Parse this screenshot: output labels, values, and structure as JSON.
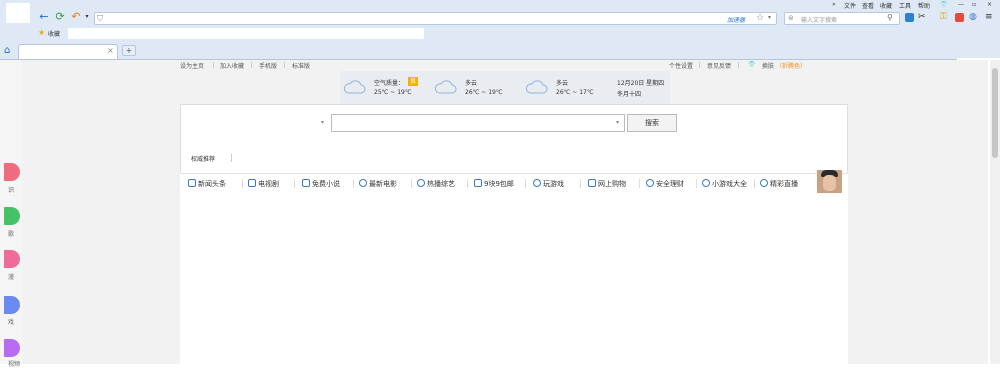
{
  "browser": {
    "menu": [
      "文件",
      "查看",
      "收藏",
      "工具",
      "帮助"
    ],
    "accelerator_label": "加速器",
    "search_placeholder": "输入文字搜索",
    "favorites_label": "收藏",
    "new_tab_symbol": "+",
    "tab_close_symbol": "×",
    "expand_symbol": "»"
  },
  "page": {
    "top_links_left": [
      "设为主页",
      "加入收藏",
      "手机版",
      "标准版"
    ],
    "top_links_right": [
      "个性设置",
      "意见反馈"
    ],
    "skin_label": "换肤",
    "skin_extra": "（折腾色）",
    "weather": {
      "aqi_label": "空气质量：",
      "aqi_value": "良",
      "days": [
        {
          "title": "空气质量：",
          "temp": "25℃ ~ 19℃"
        },
        {
          "title": "多云",
          "temp": "26℃ ~ 19℃"
        },
        {
          "title": "多云",
          "temp": "26℃ ~ 17℃"
        }
      ],
      "date": "12月20日 星期四",
      "lunar": "冬月十四"
    },
    "search_button": "搜索",
    "authority_tab": "权威推荐",
    "nav": [
      "新闻头条",
      "电视剧",
      "免费小说",
      "最新电影",
      "热播综艺",
      "9块9包邮",
      "玩游戏",
      "网上购物",
      "安全理财",
      "小游戏大全",
      "精彩直播"
    ],
    "side_labels": [
      "识",
      "歌",
      "漫",
      "戏",
      "视频"
    ]
  },
  "colors": {
    "accent": "#3a79c9",
    "skin": "#f28a1e",
    "aqi_badge": "#f5b300"
  }
}
